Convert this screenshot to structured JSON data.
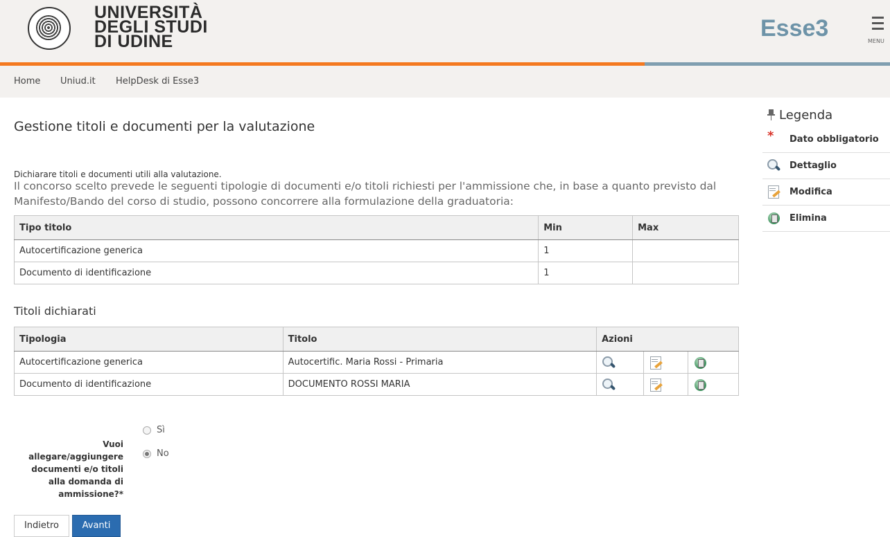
{
  "header": {
    "university_lines": [
      "UNIVERSITÀ",
      "DEGLI STUDI",
      "DI UDINE"
    ],
    "app_name": "Esse3",
    "menu_label": "MENU"
  },
  "nav": {
    "links": [
      "Home",
      "Uniud.it",
      "HelpDesk di Esse3"
    ]
  },
  "page": {
    "title": "Gestione titoli e documenti per la valutazione",
    "subtitle": "Dichiarare titoli e documenti utili alla valutazione.",
    "intro": "Il concorso scelto prevede le seguenti tipologie di documenti e/o titoli richiesti per l'ammissione che, in base a quanto previsto dal Manifesto/Bando del corso di studio, possono concorrere alla formulazione della graduatoria:"
  },
  "required_table": {
    "headers": [
      "Tipo titolo",
      "Min",
      "Max"
    ],
    "rows": [
      [
        "Autocertificazione generica",
        "1",
        ""
      ],
      [
        "Documento di identificazione",
        "1",
        ""
      ]
    ]
  },
  "declared": {
    "section_title": "Titoli dichiarati",
    "headers": [
      "Tipologia",
      "Titolo",
      "Azioni"
    ],
    "rows": [
      [
        "Autocertificazione generica",
        "Autocertific. Maria Rossi - Primaria"
      ],
      [
        "Documento di identificazione",
        "DOCUMENTO ROSSI MARIA"
      ]
    ]
  },
  "form": {
    "question": "Vuoi allegare/aggiungere documenti e/o titoli alla domanda di ammissione?*",
    "options": [
      "Sì",
      "No"
    ],
    "selected": "No",
    "back_label": "Indietro",
    "next_label": "Avanti"
  },
  "legend": {
    "title": "Legenda",
    "items": [
      "Dato obbligatorio",
      "Dettaglio",
      "Modifica",
      "Elimina"
    ]
  },
  "colors": {
    "accent_orange": "#f47920",
    "accent_blue": "#7f9eb0",
    "primary_button": "#2b6cb0",
    "required_star": "#d9352b"
  }
}
